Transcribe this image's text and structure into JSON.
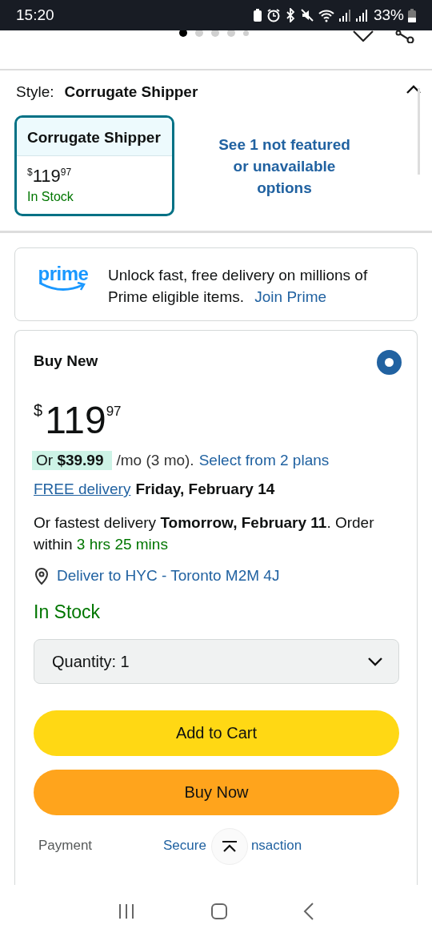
{
  "status_bar": {
    "time": "15:20",
    "battery": "33%"
  },
  "gallery": {
    "dots": [
      {
        "selected": true
      },
      {
        "selected": false
      },
      {
        "selected": false
      },
      {
        "selected": false
      },
      {
        "selected": false
      }
    ]
  },
  "style": {
    "label": "Style:",
    "value": "Corrugate Shipper",
    "expanded": true,
    "options": [
      {
        "name": "Corrugate Shipper",
        "currency": "$",
        "price_whole": "119",
        "price_fraction": "97",
        "availability": "In Stock",
        "selected": true
      }
    ],
    "more_link": "See 1 not featured or unavailable options"
  },
  "prime": {
    "logo": "prime",
    "text": "Unlock fast, free delivery on millions of Prime eligible items.",
    "link": "Join Prime"
  },
  "buy_box": {
    "title": "Buy New",
    "selected": true,
    "currency": "$",
    "price_whole": "119",
    "price_fraction": "97",
    "installment": {
      "badge": "Or **$39.99**",
      "terms": "/mo (3 mo).",
      "link": "Select from 2 plans"
    },
    "delivery": {
      "link": "FREE delivery",
      "date": "Friday, February 14"
    },
    "fastest": "Or fastest delivery **Tomorrow, February 11**. Order within",
    "countdown": "3 hrs 25 mins",
    "location": "Deliver to HYC - Toronto M2M 4J",
    "stock": "In Stock",
    "quantity": "Quantity: 1",
    "buttons": [
      {
        "label": "Add to Cart",
        "kind": "cart"
      },
      {
        "label": "Buy Now",
        "kind": "buy"
      }
    ],
    "details": [
      {
        "label": "Payment",
        "value": "Secure",
        "value_tail": "nsaction"
      }
    ]
  }
}
